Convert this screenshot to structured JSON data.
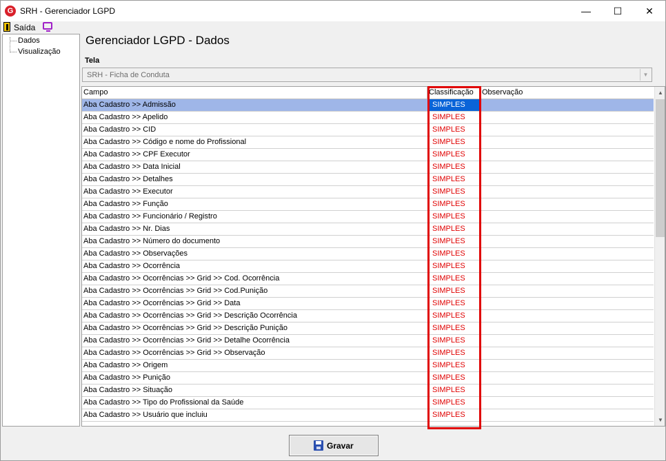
{
  "window": {
    "title": "SRH - Gerenciador LGPD",
    "app_icon_letter": "G",
    "minimize_glyph": "—",
    "maximize_glyph": "☐",
    "close_glyph": "✕"
  },
  "toolbar": {
    "exit_label": "Saída",
    "exit_icon": "door-exit-icon",
    "monitor_icon": "monitor-icon"
  },
  "tree": {
    "items": [
      {
        "label": "Dados"
      },
      {
        "label": "Visualização"
      }
    ]
  },
  "main": {
    "title": "Gerenciador LGPD - Dados",
    "tela_label": "Tela",
    "tela_value": "SRH - Ficha de Conduta",
    "dropdown_glyph": "▼"
  },
  "grid": {
    "columns": [
      "Campo",
      "Classificação",
      "Observação"
    ],
    "selected_row": 0,
    "rows": [
      {
        "campo": "Aba Cadastro >> Admissão",
        "classificacao": "SIMPLES",
        "observacao": ""
      },
      {
        "campo": "Aba Cadastro >> Apelido",
        "classificacao": "SIMPLES",
        "observacao": ""
      },
      {
        "campo": "Aba Cadastro >> CID",
        "classificacao": "SIMPLES",
        "observacao": ""
      },
      {
        "campo": "Aba Cadastro >> Código e nome do Profissional",
        "classificacao": "SIMPLES",
        "observacao": ""
      },
      {
        "campo": "Aba Cadastro >> CPF Executor",
        "classificacao": "SIMPLES",
        "observacao": ""
      },
      {
        "campo": "Aba Cadastro >> Data Inicial",
        "classificacao": "SIMPLES",
        "observacao": ""
      },
      {
        "campo": "Aba Cadastro >> Detalhes",
        "classificacao": "SIMPLES",
        "observacao": ""
      },
      {
        "campo": "Aba Cadastro >> Executor",
        "classificacao": "SIMPLES",
        "observacao": ""
      },
      {
        "campo": "Aba Cadastro >> Função",
        "classificacao": "SIMPLES",
        "observacao": ""
      },
      {
        "campo": "Aba Cadastro >> Funcionário / Registro",
        "classificacao": "SIMPLES",
        "observacao": ""
      },
      {
        "campo": "Aba Cadastro >> Nr. Dias",
        "classificacao": "SIMPLES",
        "observacao": ""
      },
      {
        "campo": "Aba Cadastro >> Número do documento",
        "classificacao": "SIMPLES",
        "observacao": ""
      },
      {
        "campo": "Aba Cadastro >> Observações",
        "classificacao": "SIMPLES",
        "observacao": ""
      },
      {
        "campo": "Aba Cadastro >> Ocorrência",
        "classificacao": "SIMPLES",
        "observacao": ""
      },
      {
        "campo": "Aba Cadastro >> Ocorrências >> Grid >> Cod. Ocorrência",
        "classificacao": "SIMPLES",
        "observacao": ""
      },
      {
        "campo": "Aba Cadastro >> Ocorrências >> Grid >> Cod.Punição",
        "classificacao": "SIMPLES",
        "observacao": ""
      },
      {
        "campo": "Aba Cadastro >> Ocorrências >> Grid >> Data",
        "classificacao": "SIMPLES",
        "observacao": ""
      },
      {
        "campo": "Aba Cadastro >> Ocorrências >> Grid >> Descrição Ocorrência",
        "classificacao": "SIMPLES",
        "observacao": ""
      },
      {
        "campo": "Aba Cadastro >> Ocorrências >> Grid >> Descrição Punição",
        "classificacao": "SIMPLES",
        "observacao": ""
      },
      {
        "campo": "Aba Cadastro >> Ocorrências >> Grid >> Detalhe Ocorrência",
        "classificacao": "SIMPLES",
        "observacao": ""
      },
      {
        "campo": "Aba Cadastro >> Ocorrências >> Grid >> Observação",
        "classificacao": "SIMPLES",
        "observacao": ""
      },
      {
        "campo": "Aba Cadastro >> Origem",
        "classificacao": "SIMPLES",
        "observacao": ""
      },
      {
        "campo": "Aba Cadastro >> Punição",
        "classificacao": "SIMPLES",
        "observacao": ""
      },
      {
        "campo": "Aba Cadastro >> Situação",
        "classificacao": "SIMPLES",
        "observacao": ""
      },
      {
        "campo": "Aba Cadastro >> Tipo do Profissional da Saúde",
        "classificacao": "SIMPLES",
        "observacao": ""
      },
      {
        "campo": "Aba Cadastro >> Usuário que incluiu",
        "classificacao": "SIMPLES",
        "observacao": ""
      }
    ],
    "scroll_up_glyph": "▲",
    "scroll_down_glyph": "▼"
  },
  "footer": {
    "save_label": "Gravar",
    "save_icon": "floppy-disk-icon"
  },
  "colors": {
    "classification_text": "#e00000",
    "selected_row": "#9fb6e8",
    "selected_cell": "#0a64d8",
    "highlight_border": "#e00000"
  }
}
